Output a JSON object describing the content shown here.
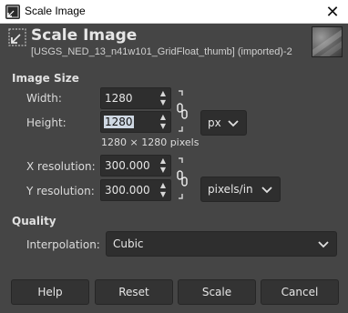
{
  "window": {
    "title": "Scale Image",
    "close_glyph": "✕"
  },
  "header": {
    "title": "Scale Image",
    "subtitle": "[USGS_NED_13_n41w101_GridFloat_thumb] (imported)-2",
    "icon": "scale-image-icon",
    "thumbnail": "image-thumbnail"
  },
  "image_size": {
    "section_label": "Image Size",
    "width_label": "Width:",
    "width_value": "1280",
    "height_label": "Height:",
    "height_value": "1280",
    "dimensions_text": "1280 × 1280 pixels",
    "unit": "px",
    "x_res_label": "X resolution:",
    "x_res_value": "300.000",
    "y_res_label": "Y resolution:",
    "y_res_value": "300.000",
    "res_unit": "pixels/in"
  },
  "quality": {
    "section_label": "Quality",
    "interpolation_label": "Interpolation:",
    "interpolation_value": "Cubic"
  },
  "buttons": {
    "help": "Help",
    "reset": "Reset",
    "scale": "Scale",
    "cancel": "Cancel"
  },
  "colors": {
    "dialog_bg": "#454545",
    "field_bg": "#2e2e2e",
    "selection_bg": "#cfd8e3"
  }
}
